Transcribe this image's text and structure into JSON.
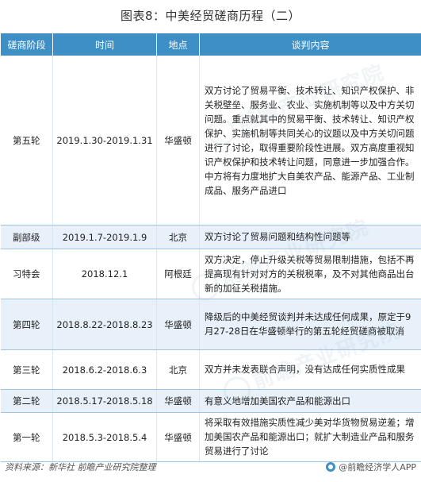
{
  "title": "图表8：中美经贸磋商历程（二）",
  "columns": [
    "磋商阶段",
    "时间",
    "地点",
    "谈判内容"
  ],
  "rows": [
    {
      "stage": "第五轮",
      "time": "2019.1.30-2019.1.31",
      "place": "华盛顿",
      "content": "双方讨论了贸易平衡、技术转让、知识产权保护、非关税壁垒、服务业、农业、实施机制等以及中方关切问题。重点就其中的贸易平衡、技术转让、知识产权保护、实施机制等共同关心的议题以及中方关切问题进行了讨论，取得重要阶段性进展。双方高度重视知识产权保护和技术转让问题，同意进一步加强合作。中方将有力度地扩大自美农产品、能源产品、工业制成品、服务产品进口"
    },
    {
      "stage": "副部级",
      "time": "2019.1.7-2019.1.9",
      "place": "北京",
      "content": "双方讨论了贸易问题和结构性问题等"
    },
    {
      "stage": "习特会",
      "time": "2018.12.1",
      "place": "阿根廷",
      "content": "双方决定，停止升级关税等贸易限制措施，包括不再提高现有针对对方的关税税率，及不对其他商品出台新的加征关税措施。"
    },
    {
      "stage": "第四轮",
      "time": "2018.8.22-2018.8.23",
      "place": "华盛顿",
      "content": "降级后的中美经贸谈判并未达成任何成果，原定于9月27-28日在华盛顿举行的第五轮经贸磋商被取消"
    },
    {
      "stage": "第三轮",
      "time": "2018.6.2-2018.6.3",
      "place": "北京",
      "content": "双方并未发表联合声明，没有达成任何实质性成果"
    },
    {
      "stage": "第二轮",
      "time": "2018.5.17-2018.5.18",
      "place": "华盛顿",
      "content": "有意义地增加美国农产品和能源出口"
    },
    {
      "stage": "第一轮",
      "time": "2018.5.3-2018.5.4",
      "place": "华盛顿",
      "content": "将采取有效措施实质性减少美对华货物贸易逆差；增加美国农产品和能源出口；就扩大制造业产品和服务贸易进行了讨论"
    }
  ],
  "watermark": "前瞻产业研究院",
  "footer": {
    "source": "资料来源：新华社  前瞻产业研究院整理",
    "brand": "@前瞻经济学人APP"
  }
}
